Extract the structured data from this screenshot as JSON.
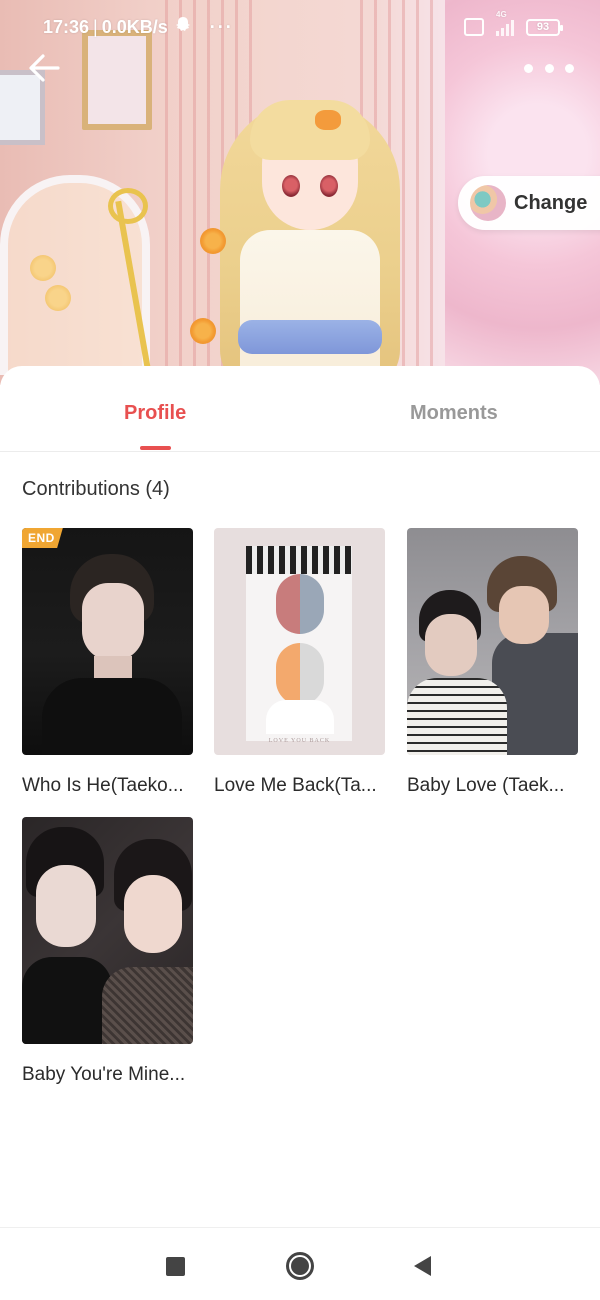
{
  "status_bar": {
    "time": "17:36",
    "separator": "|",
    "net_speed": "0.0KB/s",
    "more_dots": "···",
    "sim_label": "▣",
    "signal_label": "4G",
    "battery": "93"
  },
  "header": {
    "back_icon": "arrow-left-icon",
    "more_icon": "more-horizontal-icon",
    "change_label": "Change"
  },
  "tabs": [
    {
      "label": "Profile",
      "active": true
    },
    {
      "label": "Moments",
      "active": false
    }
  ],
  "contributions": {
    "title": "Contributions (4)",
    "books": [
      {
        "title": "Who Is He(Taeko...",
        "badge": "END"
      },
      {
        "title": "Love Me Back(Ta...",
        "badge": ""
      },
      {
        "title": "Baby Love (Taek...",
        "badge": ""
      },
      {
        "title": "Baby You're Mine...",
        "badge": ""
      }
    ],
    "cover2_caption": "LOVE YOU BACK"
  },
  "colors": {
    "accent": "#e85050",
    "inactive_tab": "#999999",
    "badge": "#f0a632"
  },
  "navigation": {
    "recent_icon": "square-icon",
    "home_icon": "circle-icon",
    "back_icon": "triangle-back-icon"
  }
}
